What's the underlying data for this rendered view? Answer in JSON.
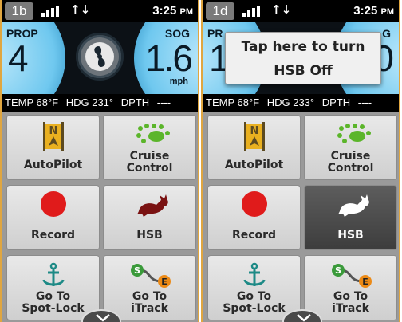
{
  "left": {
    "screen_id": "1b",
    "clock": {
      "time": "3:25",
      "ampm": "PM"
    },
    "prop": {
      "label": "PROP",
      "value": "4"
    },
    "sog": {
      "label": "SOG",
      "value": "1.6",
      "unit": "mph"
    },
    "info": {
      "temp": "TEMP 68°F",
      "heading": "HDG 231°",
      "depth": "DPTH",
      "depth_value": "----"
    },
    "tiles": [
      {
        "label": "AutoPilot"
      },
      {
        "label_line1": "Cruise",
        "label_line2": "Control"
      },
      {
        "label": "Record"
      },
      {
        "label": "HSB"
      },
      {
        "label_line1": "Go To",
        "label_line2": "Spot-Lock"
      },
      {
        "label_line1": "Go To",
        "label_line2": "iTrack"
      }
    ]
  },
  "right": {
    "screen_id": "1d",
    "clock": {
      "time": "3:25",
      "ampm": "PM"
    },
    "prop": {
      "label": "PR",
      "value": "1"
    },
    "sog": {
      "label": "G",
      "value": "0"
    },
    "info": {
      "temp": "TEMP 68°F",
      "heading": "HDG 233°",
      "depth": "DPTH",
      "depth_value": "----"
    },
    "popup": {
      "line1": "Tap here to turn",
      "line2": "HSB Off"
    },
    "tiles": [
      {
        "label": "AutoPilot"
      },
      {
        "label_line1": "Cruise",
        "label_line2": "Control"
      },
      {
        "label": "Record"
      },
      {
        "label": "HSB"
      },
      {
        "label_line1": "Go To",
        "label_line2": "Spot-Lock"
      },
      {
        "label_line1": "Go To",
        "label_line2": "iTrack"
      }
    ]
  },
  "icons": {
    "autopilot": "autopilot-icon",
    "cruise": "cruise-control-icon",
    "record": "record-icon",
    "hsb": "rabbit-icon",
    "spotlock": "anchor-icon",
    "itrack": "track-icon"
  },
  "colors": {
    "accent": "#e0a640",
    "record": "#e01b1b",
    "gauge": "#6fc8ef",
    "cruise": "#5bb52a"
  }
}
